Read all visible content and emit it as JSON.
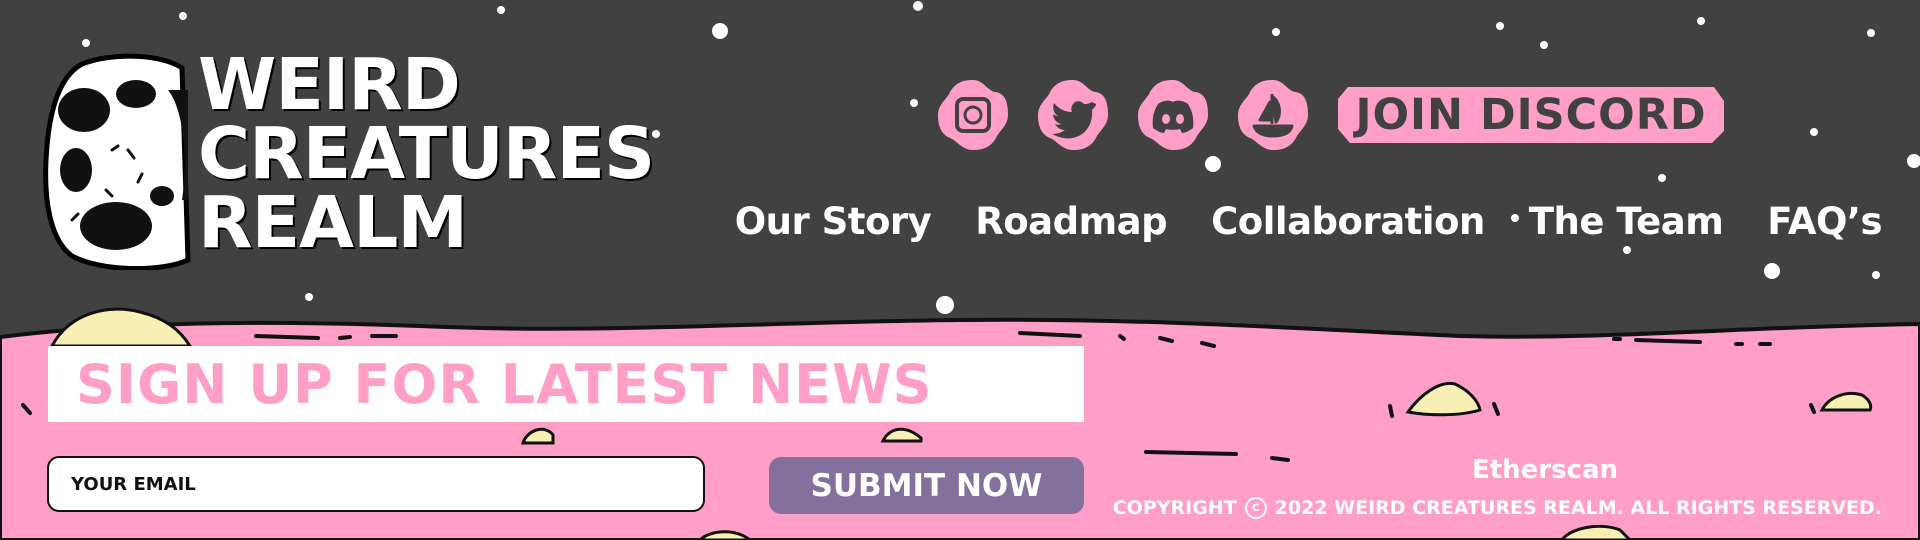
{
  "logo": {
    "lines": [
      "WEIRD",
      "CREATURES",
      "REALM"
    ]
  },
  "social": [
    {
      "name": "instagram",
      "icon": "instagram-icon"
    },
    {
      "name": "twitter",
      "icon": "twitter-icon"
    },
    {
      "name": "discord",
      "icon": "discord-icon"
    },
    {
      "name": "opensea",
      "icon": "opensea-icon"
    }
  ],
  "join_discord_label": "JOIN DISCORD",
  "nav": [
    "Our Story",
    "Roadmap",
    "Collaboration",
    "The Team",
    "FAQ’s"
  ],
  "newsletter": {
    "heading": "SIGN UP FOR LATEST NEWS",
    "email_placeholder": "YOUR EMAIL",
    "submit_label": "SUBMIT NOW"
  },
  "footer": {
    "etherscan": "Etherscan",
    "copyright_prefix": "COPYRIGHT",
    "copyright_symbol": "c",
    "copyright_text": "2022 WEIRD CREATURES REALM. ALL RIGHTS RESERVED."
  },
  "colors": {
    "background": "#414141",
    "pink": "#ff9fc8",
    "purple": "#84709c",
    "rock": "#f7efb3"
  }
}
